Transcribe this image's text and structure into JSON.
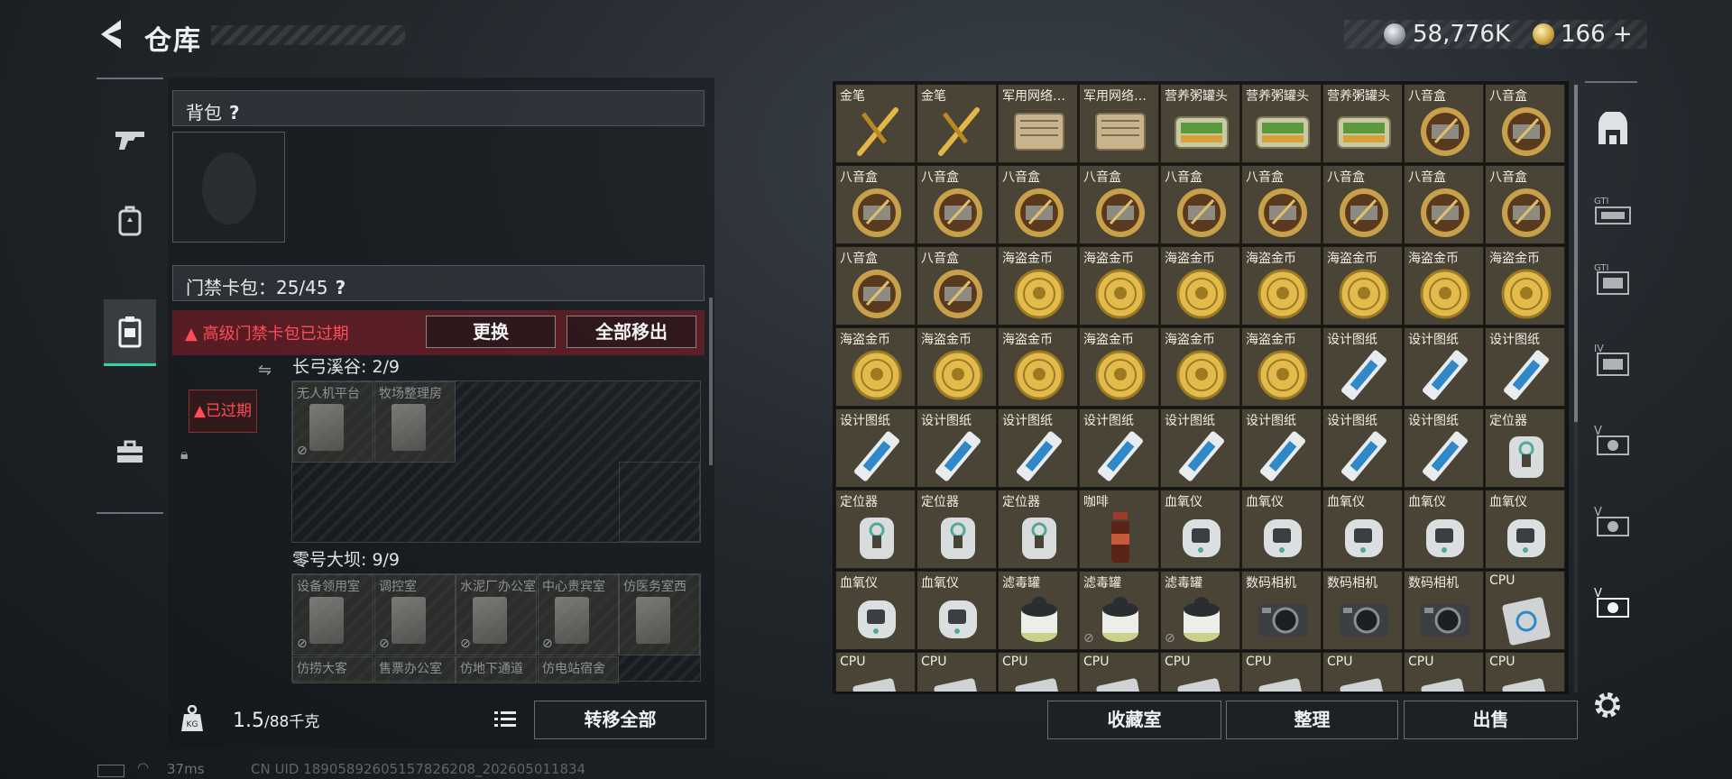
{
  "header": {
    "title": "仓库"
  },
  "currency": {
    "silver": "58,776K",
    "gold": "166",
    "gold_plus": "+"
  },
  "left_nav": [
    "weapon",
    "armor",
    "keycard",
    "toolbox"
  ],
  "backpack": {
    "label": "背包",
    "help": "?"
  },
  "keycard": {
    "label": "门禁卡包：25/45",
    "help": "?",
    "warning": "高级门禁卡包已过期",
    "replace_btn": "更换",
    "remove_all_btn": "全部移出",
    "expired_label": "已过期",
    "maps": [
      {
        "name": "长弓溪谷: 2/9",
        "keys": [
          "无人机平台",
          "牧场整理房"
        ]
      },
      {
        "name": "零号大坝: 9/9",
        "keys": [
          "设备领用室",
          "调控室",
          "水泥厂办公室",
          "中心贵宾室",
          "仿医务室西",
          "仿捞大客",
          "售票办公室",
          "仿地下通道",
          "仿电站宿舍"
        ]
      }
    ]
  },
  "weight": {
    "current": "1.5",
    "max": "/88千克"
  },
  "transfer_btn": "转移全部",
  "status": {
    "ping": "37ms",
    "uid": "CN UID 18905892605157826208_202605011834"
  },
  "warehouse": {
    "rows": [
      [
        "金笔",
        "金笔",
        "军用网络…",
        "军用网络…",
        "营养粥罐头",
        "营养粥罐头",
        "营养粥罐头",
        "八音盒",
        "八音盒"
      ],
      [
        "八音盒",
        "八音盒",
        "八音盒",
        "八音盒",
        "八音盒",
        "八音盒",
        "八音盒",
        "八音盒",
        "八音盒"
      ],
      [
        "八音盒",
        "八音盒",
        "海盗金币",
        "海盗金币",
        "海盗金币",
        "海盗金币",
        "海盗金币",
        "海盗金币",
        "海盗金币"
      ],
      [
        "海盗金币",
        "海盗金币",
        "海盗金币",
        "海盗金币",
        "海盗金币",
        "海盗金币",
        "设计图纸",
        "设计图纸",
        "设计图纸"
      ],
      [
        "设计图纸",
        "设计图纸",
        "设计图纸",
        "设计图纸",
        "设计图纸",
        "设计图纸",
        "设计图纸",
        "设计图纸",
        "定位器"
      ],
      [
        "定位器",
        "定位器",
        "定位器",
        "咖啡",
        "血氧仪",
        "血氧仪",
        "血氧仪",
        "血氧仪",
        "血氧仪"
      ],
      [
        "血氧仪",
        "血氧仪",
        "滤毒罐",
        "滤毒罐",
        "滤毒罐",
        "数码相机",
        "数码相机",
        "数码相机",
        "CPU"
      ],
      [
        "CPU",
        "CPU",
        "CPU",
        "CPU",
        "CPU",
        "CPU",
        "CPU",
        "CPU",
        "CPU"
      ]
    ]
  },
  "right_nav": [
    "all",
    "GTI",
    "GTI-2",
    "IV",
    "V-1",
    "V-2",
    "V-3"
  ],
  "bottom_buttons": {
    "collection": "收藏室",
    "sort": "整理",
    "sell": "出售"
  }
}
